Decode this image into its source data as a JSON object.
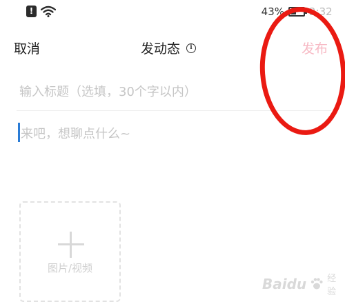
{
  "status_bar": {
    "alert_symbol": "!",
    "battery_percent": "43%",
    "battery_level": 0.43,
    "time": "2:32"
  },
  "header": {
    "cancel_label": "取消",
    "title": "发动态",
    "info_symbol": "i",
    "publish_label": "发布"
  },
  "form": {
    "title_placeholder": "输入标题（选填，30个字以内）",
    "title_value": "",
    "content_placeholder": "来吧，想聊点什么~",
    "content_value": ""
  },
  "media_picker": {
    "label": "图片/视频"
  },
  "watermark": {
    "text": "Baidu",
    "sub": "经验"
  },
  "colors": {
    "publish_disabled": "#f7b9c4",
    "annotation_circle": "#ea1a12",
    "cursor": "#2a7cd6"
  },
  "icons": [
    "alert-icon",
    "wifi-icon",
    "battery-icon",
    "info-icon",
    "plus-icon"
  ]
}
